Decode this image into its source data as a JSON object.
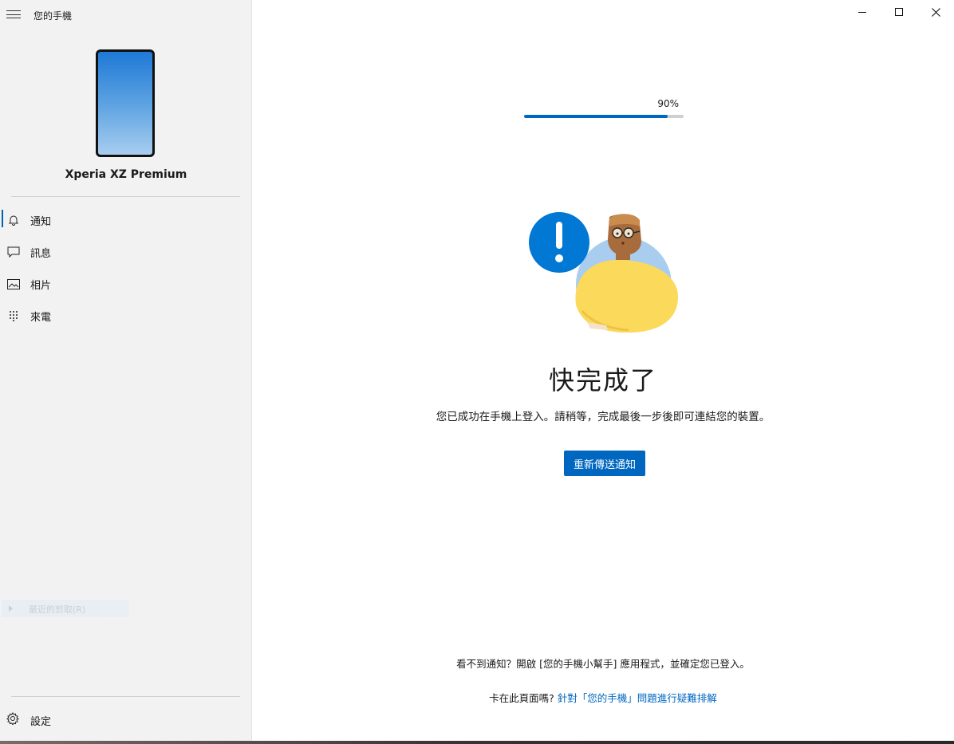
{
  "app": {
    "title": "您的手機"
  },
  "device": {
    "name": "Xperia XZ Premium"
  },
  "nav": {
    "items": [
      {
        "label": "通知",
        "icon": "bell-icon",
        "active": true
      },
      {
        "label": "訊息",
        "icon": "chat-icon",
        "active": false
      },
      {
        "label": "相片",
        "icon": "photo-icon",
        "active": false
      },
      {
        "label": "來電",
        "icon": "dialpad-icon",
        "active": false
      }
    ],
    "settings_label": "設定"
  },
  "ghost_menu": {
    "label": "最近的剪取(R)"
  },
  "progress": {
    "label": "90%",
    "value": 0.9
  },
  "main": {
    "heading": "快完成了",
    "subtext": "您已成功在手機上登入。請稍等，完成最後一步後即可連結您的裝置。",
    "resend_button": "重新傳送通知",
    "footer_hint": "看不到通知？開啟 [您的手機小幫手] 應用程式，並確定您已登入。",
    "stuck_prefix": "卡在此頁面嗎?",
    "stuck_link": "針對「您的手機」問題進行疑難排解"
  },
  "colors": {
    "accent": "#0067c0",
    "sidebar_bg": "#f2f2f2",
    "illustration_yellow": "#fbd95b",
    "illustration_blue": "#0078d4"
  }
}
